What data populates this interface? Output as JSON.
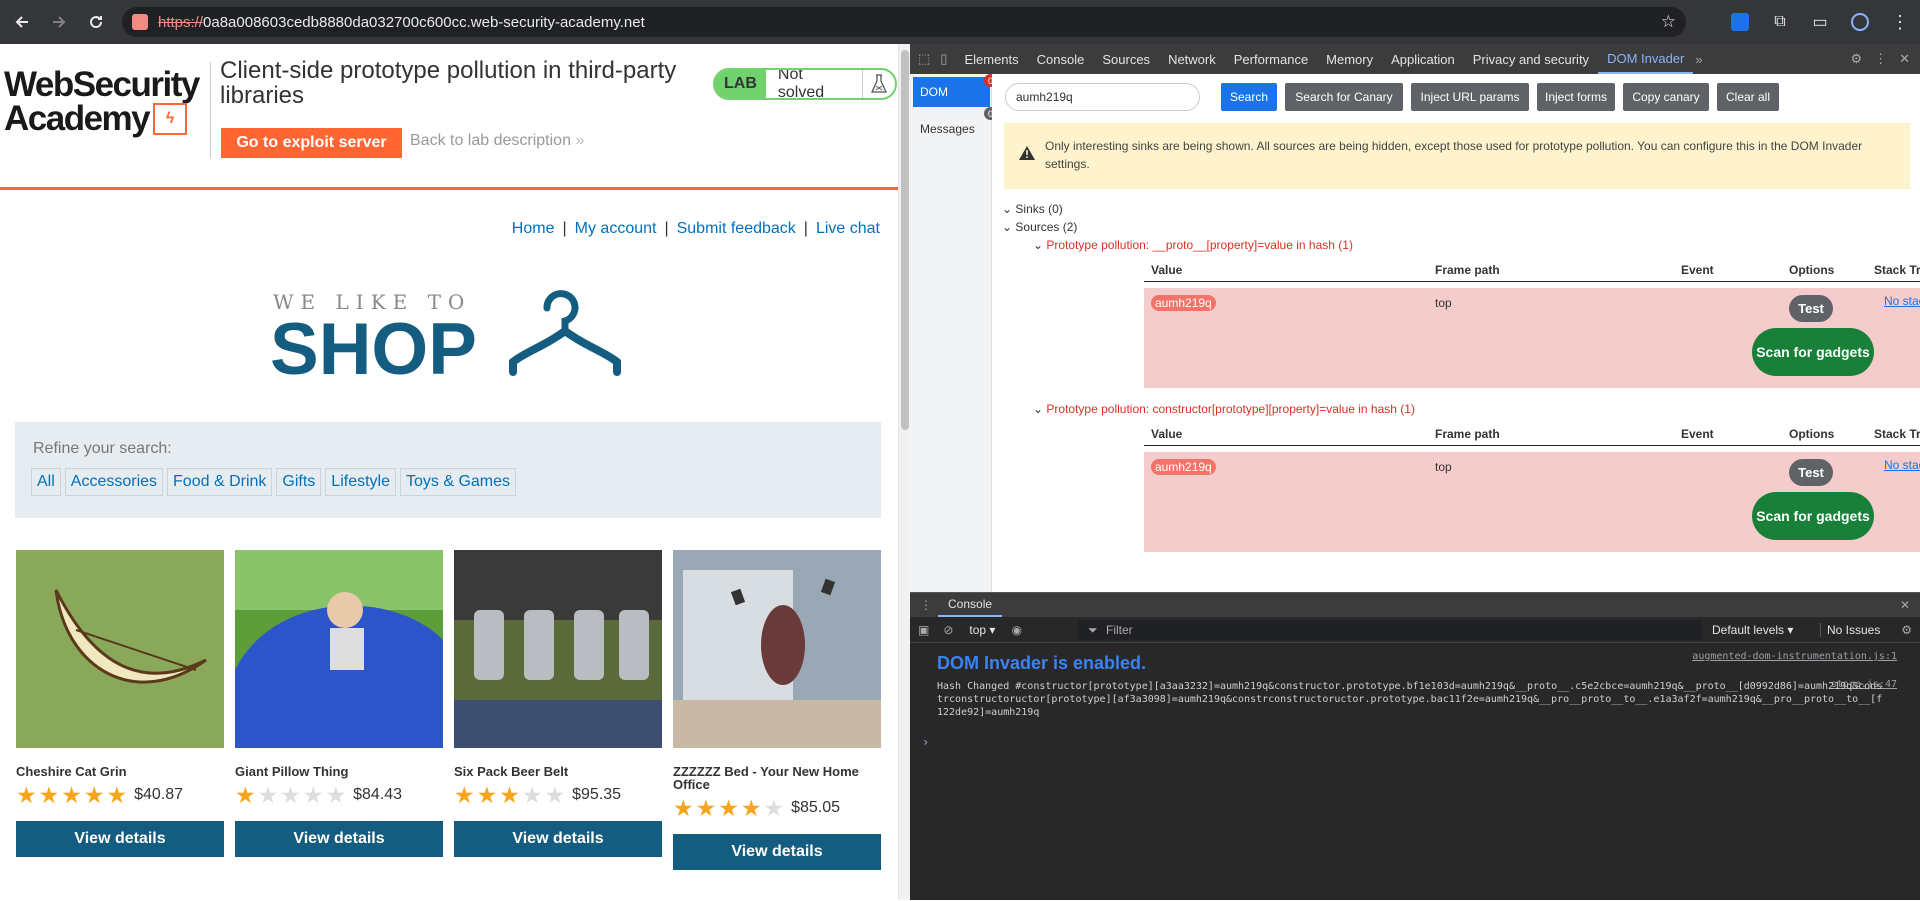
{
  "browser": {
    "url_scheme": "https://",
    "url_rest": "0a8a008603cedb8880da032700c600cc.web-security-academy.net"
  },
  "lab": {
    "logo_line1": "WebSecurity",
    "logo_line2": "Academy",
    "title": "Client-side prototype pollution in third-party libraries",
    "exploit_button": "Go to exploit server",
    "back_link": "Back to lab description",
    "badge": "LAB",
    "status": "Not solved"
  },
  "nav": {
    "home": "Home",
    "account": "My account",
    "feedback": "Submit feedback",
    "chat": "Live chat",
    "sep": "|"
  },
  "shop": {
    "tagline": "WE LIKE TO",
    "word": "SHOP"
  },
  "refine": {
    "label": "Refine your search:",
    "filters": [
      "All",
      "Accessories",
      "Food & Drink",
      "Gifts",
      "Lifestyle",
      "Toys & Games"
    ]
  },
  "products": [
    {
      "name": "Cheshire Cat Grin",
      "price": "$40.87",
      "rating": 5,
      "button": "View details"
    },
    {
      "name": "Giant Pillow Thing",
      "price": "$84.43",
      "rating": 1,
      "button": "View details"
    },
    {
      "name": "Six Pack Beer Belt",
      "price": "$95.35",
      "rating": 3,
      "button": "View details"
    },
    {
      "name": "ZZZZZZ Bed - Your New Home Office",
      "price": "$85.05",
      "rating": 4,
      "button": "View details"
    }
  ],
  "devtools": {
    "tabs": [
      "Elements",
      "Console",
      "Sources",
      "Network",
      "Performance",
      "Memory",
      "Application",
      "Privacy and security",
      "DOM Invader"
    ],
    "active_tab": "DOM Invader",
    "side": {
      "dom": "DOM",
      "dom_count": "0",
      "messages": "Messages",
      "messages_count": "0"
    },
    "canary": "aumh219q",
    "buttons": {
      "search": "Search",
      "search_canary": "Search for Canary",
      "inject_url": "Inject URL params",
      "inject_forms": "Inject forms",
      "copy_canary": "Copy canary",
      "clear_all": "Clear all"
    },
    "warning": "Only interesting sinks are being shown. All sources are being hidden, except those used for prototype pollution. You can configure this in the DOM Invader settings.",
    "sinks": "Sinks (0)",
    "sources": "Sources (2)",
    "columns": {
      "value": "Value",
      "frame": "Frame path",
      "event": "Event",
      "options": "Options",
      "stack": "Stack Trace"
    },
    "groups": [
      {
        "title": "Prototype pollution: __proto__[property]=value in hash (1)",
        "value": "aumh219q",
        "frame": "top",
        "test": "Test",
        "scan": "Scan for gadgets",
        "stack": "No stack trace a..."
      },
      {
        "title": "Prototype pollution: constructor[prototype][property]=value in hash (1)",
        "value": "aumh219q",
        "frame": "top",
        "test": "Test",
        "scan": "Scan for gadgets",
        "stack": "No stack trace a..."
      }
    ]
  },
  "console": {
    "tab": "Console",
    "context": "top",
    "filter_placeholder": "Filter",
    "levels": "Default levels",
    "issues": "No Issues",
    "enabled_msg": "DOM Invader is enabled.",
    "enabled_src": "augmented-dom-instrumentation.js:1",
    "hash_src": "store.js:47",
    "hash_msg": "Hash Changed #constructor[prototype][a3aa3232]=aumh219q&constructor.prototype.bf1e103d=aumh219q&__proto__.c5e2cbce=aumh219q&__proto__[d0992d86]=aumh219q&constrconstructoructor[prototype][af3a3098]=aumh219q&constrconstructoructor.prototype.bac11f2e=aumh219q&__pro__proto__to__.e1a3af2f=aumh219q&__pro__proto__to__[f122de92]=aumh219q"
  }
}
